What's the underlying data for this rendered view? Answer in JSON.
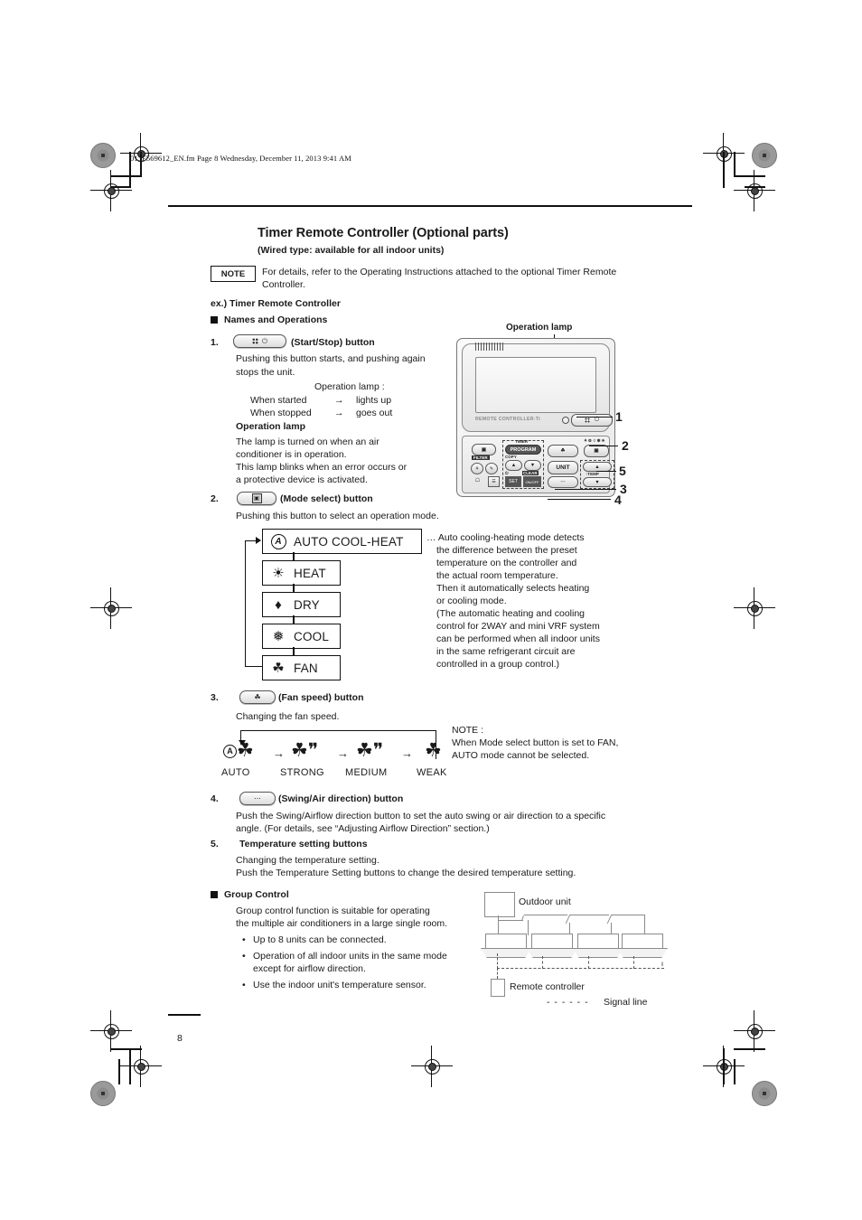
{
  "header": {
    "file_line": "01_F569612_EN.fm  Page 8  Wednesday, December 11, 2013  9:41 AM"
  },
  "title": "Timer Remote Controller (Optional parts)",
  "subtitle": "(Wired type: available for all indoor units)",
  "note": {
    "label": "NOTE",
    "text": "For details, refer to the Operating Instructions attached to the optional Timer Remote Controller."
  },
  "example_heading": "ex.) Timer Remote Controller",
  "section_names_operations": "Names and Operations",
  "items": {
    "item1": {
      "number": "1.",
      "label": "(Start/Stop) button",
      "body": "Pushing this button starts, and pushing again stops the unit.",
      "lamp_col_header": "Operation lamp :",
      "rows": [
        {
          "state": "When started",
          "arrow": "→",
          "result": "lights up"
        },
        {
          "state": "When stopped",
          "arrow": "→",
          "result": "goes out"
        }
      ],
      "lamp_heading": "Operation lamp",
      "lamp_body": "The lamp is turned on when an air conditioner is in operation. This lamp blinks when an error occurs or a protective device is activated.",
      "lamp_body_lines": [
        "The lamp is turned on when an air",
        "conditioner is in operation.",
        "This lamp blinks when an error occurs or",
        "a protective device is activated."
      ]
    },
    "item2": {
      "number": "2.",
      "label": "(Mode select) button",
      "body": "Pushing this button to select an operation mode.",
      "modes": [
        {
          "icon": "auto-circle-a-icon",
          "glyph": "A",
          "label": "AUTO COOL-HEAT"
        },
        {
          "icon": "sun-icon",
          "glyph": "☀",
          "label": "HEAT"
        },
        {
          "icon": "water-drop-icon",
          "glyph": "◊",
          "label": "DRY"
        },
        {
          "icon": "snowflake-icon",
          "glyph": "❅",
          "label": "COOL"
        },
        {
          "icon": "fan-icon",
          "glyph": "☘",
          "label": "FAN"
        }
      ],
      "explanation_lines": [
        "… Auto cooling-heating mode detects",
        "the difference between the preset",
        "temperature on the controller and",
        "the actual room temperature.",
        "Then it automatically selects heating",
        "or cooling mode.",
        "(The automatic heating and cooling",
        "control for 2WAY and mini VRF system",
        "can be performed when all indoor units",
        "in the same refrigerant circuit are",
        "controlled in a group control.)"
      ]
    },
    "item3": {
      "number": "3.",
      "label": "(Fan speed) button",
      "body": "Changing the fan speed.",
      "speeds": [
        "AUTO",
        "STRONG",
        "MEDIUM",
        "WEAK"
      ],
      "arrow": "→",
      "note_lines": [
        "NOTE :",
        "When Mode select button is set to FAN,",
        "AUTO mode cannot be selected."
      ]
    },
    "item4": {
      "number": "4.",
      "label": "(Swing/Air direction) button",
      "body_lines": [
        "Push the Swing/Airflow direction button to set the auto swing or air direction to a specific",
        "angle. (For details, see “Adjusting Airflow Direction” section.)"
      ]
    },
    "item5": {
      "number": "5.",
      "label": "Temperature setting buttons",
      "body_lines": [
        "Changing the temperature setting.",
        "Push the Temperature Setting buttons to change the desired temperature setting."
      ]
    }
  },
  "group_control": {
    "heading": "Group Control",
    "intro_lines": [
      "Group control function is suitable for operating",
      "the multiple air conditioners in a large single room."
    ],
    "bullets": [
      "Up to 8 units can be connected.",
      "Operation of all indoor units in the same mode except for airflow direction.",
      "Use the indoor unit's temperature sensor."
    ],
    "bullet_lines": [
      [
        "Up to 8 units can be connected."
      ],
      [
        "Operation of all indoor units in the same mode",
        "except for airflow direction."
      ],
      [
        "Use the indoor unit's temperature sensor."
      ]
    ],
    "diagram": {
      "outdoor_unit_label": "Outdoor unit",
      "remote_controller_label": "Remote controller",
      "signal_line_label": "Signal line",
      "signal_line_dashes": "- - - - - -",
      "indoor_unit_count": 4
    }
  },
  "illustration": {
    "operation_lamp_callout": "Operation lamp",
    "brand_text": "REMOTE CONTROLLER-Ti",
    "callouts": [
      "1",
      "2",
      "5",
      "3",
      "4"
    ],
    "panel": {
      "timer_label": "TIMER",
      "program_label": "PROGRAM",
      "copy_label": "COPY",
      "set_label": "SET",
      "clear_label": "CLEAR",
      "unit_label": "UNIT",
      "temp_label": "TEMP",
      "up_arrow": "▲",
      "down_arrow": "▼"
    }
  },
  "page_number": "8"
}
